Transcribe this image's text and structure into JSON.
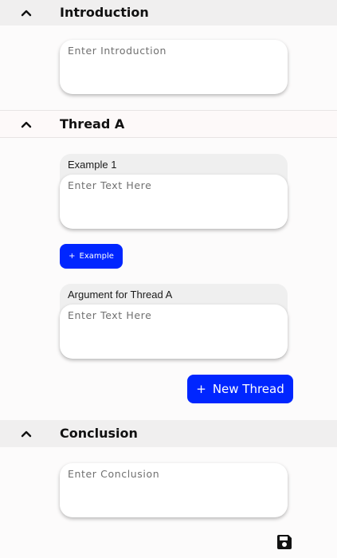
{
  "sections": {
    "introduction": {
      "title": "Introduction",
      "placeholder": "Enter Introduction",
      "chevron_icon": "chevron-up-icon"
    },
    "thread": {
      "title": "Thread A",
      "chevron_icon": "chevron-up-icon",
      "example": {
        "label": "Example 1",
        "placeholder": "Enter Text Here"
      },
      "add_example_button": {
        "plus": "+",
        "label": "Example"
      },
      "argument": {
        "label": "Argument for Thread A",
        "placeholder": "Enter Text Here"
      }
    },
    "conclusion": {
      "title": "Conclusion",
      "placeholder": "Enter Conclusion",
      "chevron_icon": "chevron-up-icon"
    }
  },
  "new_thread_button": {
    "plus": "+",
    "label": "New Thread"
  },
  "save_icon": "floppy-disk-icon",
  "colors": {
    "primary": "#0026ff",
    "header_bg": "#f0efef",
    "page_bg": "#fcfbfb"
  }
}
